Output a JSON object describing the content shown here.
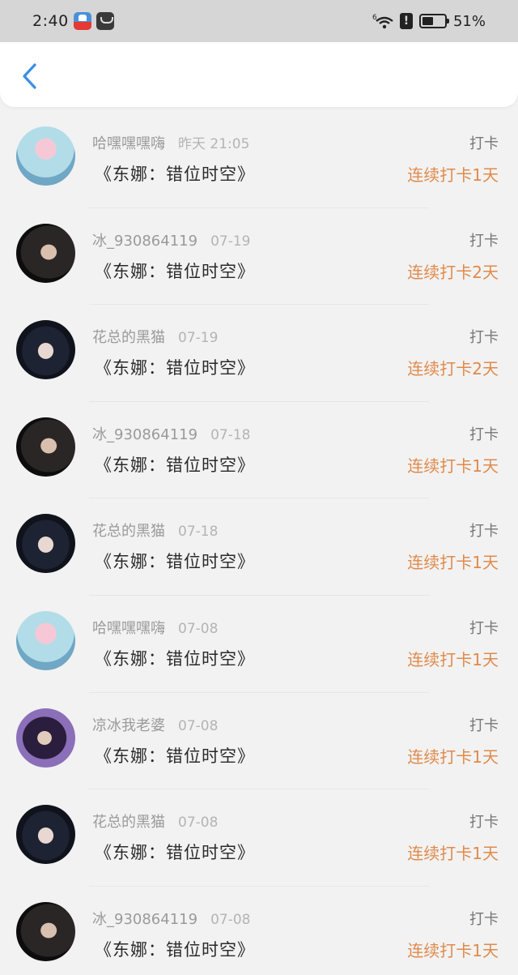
{
  "status_bar": {
    "time": "2:40",
    "signal_label": "6",
    "alert": "!",
    "battery_text": "51%",
    "battery_level": 0.51
  },
  "header": {
    "back_icon": "chevron-left-icon",
    "accent_color": "#3a8ee6"
  },
  "colors": {
    "streak": "#e08a4b",
    "name": "#9a9a9a",
    "title": "#2a2a2a"
  },
  "items": [
    {
      "user": "哈嘿嘿嘿嗨",
      "time": "昨天 21:05",
      "title": "《东娜：错位时空》",
      "label": "打卡",
      "streak": "连续打卡1天",
      "avatar": "a"
    },
    {
      "user": "冰_930864119",
      "time": "07-19",
      "title": "《东娜：错位时空》",
      "label": "打卡",
      "streak": "连续打卡2天",
      "avatar": "b"
    },
    {
      "user": "花总的黑猫",
      "time": "07-19",
      "title": "《东娜：错位时空》",
      "label": "打卡",
      "streak": "连续打卡2天",
      "avatar": "c"
    },
    {
      "user": "冰_930864119",
      "time": "07-18",
      "title": "《东娜：错位时空》",
      "label": "打卡",
      "streak": "连续打卡1天",
      "avatar": "b"
    },
    {
      "user": "花总的黑猫",
      "time": "07-18",
      "title": "《东娜：错位时空》",
      "label": "打卡",
      "streak": "连续打卡1天",
      "avatar": "c"
    },
    {
      "user": "哈嘿嘿嘿嗨",
      "time": "07-08",
      "title": "《东娜：错位时空》",
      "label": "打卡",
      "streak": "连续打卡1天",
      "avatar": "a"
    },
    {
      "user": "凉冰我老婆",
      "time": "07-08",
      "title": "《东娜：错位时空》",
      "label": "打卡",
      "streak": "连续打卡1天",
      "avatar": "d"
    },
    {
      "user": "花总的黑猫",
      "time": "07-08",
      "title": "《东娜：错位时空》",
      "label": "打卡",
      "streak": "连续打卡1天",
      "avatar": "c"
    },
    {
      "user": "冰_930864119",
      "time": "07-08",
      "title": "《东娜：错位时空》",
      "label": "打卡",
      "streak": "连续打卡1天",
      "avatar": "b"
    }
  ]
}
